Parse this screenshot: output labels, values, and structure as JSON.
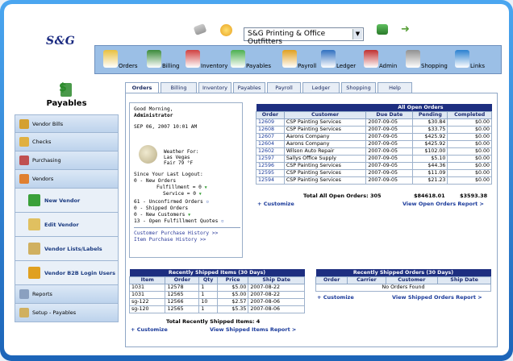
{
  "app": {
    "logo": "S&G",
    "module_title": "Payables",
    "company": "S&G Printing & Office Outfitters"
  },
  "nav": [
    {
      "label": "Orders",
      "icon": "orders-icon",
      "color": "#e8c040"
    },
    {
      "label": "Billing",
      "icon": "billing-icon",
      "color": "#3a8a3a"
    },
    {
      "label": "Inventory",
      "icon": "inventory-icon",
      "color": "#d04040"
    },
    {
      "label": "Payables",
      "icon": "payables-icon",
      "color": "#4caf50"
    },
    {
      "label": "Payroll",
      "icon": "payroll-icon",
      "color": "#e0a020"
    },
    {
      "label": "Ledger",
      "icon": "ledger-icon",
      "color": "#3070c0"
    },
    {
      "label": "Admin",
      "icon": "admin-icon",
      "color": "#c03030"
    },
    {
      "label": "Shopping",
      "icon": "shopping-icon",
      "color": "#909090"
    },
    {
      "label": "Links",
      "icon": "links-icon",
      "color": "#2a80d0"
    }
  ],
  "sidebar": {
    "items_top": [
      {
        "label": "Vendor Bills",
        "icon": "vendor-bills-icon",
        "color": "#d4a030"
      },
      {
        "label": "Checks",
        "icon": "checks-icon",
        "color": "#e0b040"
      },
      {
        "label": "Purchasing",
        "icon": "purchasing-icon",
        "color": "#c05050"
      },
      {
        "label": "Vendors",
        "icon": "vendors-icon",
        "color": "#e08030"
      }
    ],
    "sub_items": [
      {
        "label": "New Vendor",
        "icon": "plus-icon",
        "color": "#3aa03a"
      },
      {
        "label": "Edit Vendor",
        "icon": "edit-icon",
        "color": "#e0c060"
      },
      {
        "label": "Vendor Lists/Labels",
        "icon": "list-icon",
        "color": "#d0b060"
      },
      {
        "label": "Vendor B2B Login Users",
        "icon": "b2b-icon",
        "color": "#e0a020"
      }
    ],
    "items_bottom": [
      {
        "label": "Reports",
        "icon": "reports-icon",
        "color": "#8aa0c0"
      },
      {
        "label": "Setup - Payables",
        "icon": "setup-icon",
        "color": "#d0b060"
      }
    ]
  },
  "tabs": [
    "Orders",
    "Billing",
    "Inventory",
    "Payables",
    "Payroll",
    "Ledger",
    "Shopping",
    "Help"
  ],
  "greeting": {
    "hello": "Good Morning,",
    "user": "Administrator",
    "datetime": "SEP 06, 2007 10:01 AM",
    "weather_for": "Weather For:",
    "city": "Las Vegas",
    "forecast": "Fair 79 °F",
    "since": "Since Your Last Logout:",
    "new_orders": "0 - New Orders",
    "fulfillment": "Fulfillment = 0",
    "service": "Service = 0",
    "unconfirmed": "61 - Unconfirmed Orders",
    "shipped": "0 - Shipped Orders",
    "new_customers": "0 - New Customers",
    "open_quotes": "13 - Open Fulfillment Quotes",
    "link_customer": "Customer Purchase History >>",
    "link_item": "Item Purchase History >>"
  },
  "open_orders": {
    "caption": "All Open Orders",
    "headers": [
      "Order",
      "Customer",
      "Due Date",
      "Pending",
      "Completed"
    ],
    "rows": [
      [
        "12609",
        "CSP Painting Services",
        "2007-09-05",
        "$30.84",
        "$0.00"
      ],
      [
        "12608",
        "CSP Painting Services",
        "2007-09-05",
        "$33.75",
        "$0.00"
      ],
      [
        "12607",
        "Aarons Company",
        "2007-09-05",
        "$425.92",
        "$0.00"
      ],
      [
        "12604",
        "Aarons Company",
        "2007-09-05",
        "$425.92",
        "$0.00"
      ],
      [
        "12602",
        "Wilson Auto Repair",
        "2007-09-05",
        "$102.00",
        "$0.00"
      ],
      [
        "12597",
        "Sallys Office Supply",
        "2007-09-05",
        "$5.10",
        "$0.00"
      ],
      [
        "12596",
        "CSP Painting Services",
        "2007-09-05",
        "$44.36",
        "$0.00"
      ],
      [
        "12595",
        "CSP Painting Services",
        "2007-09-05",
        "$11.09",
        "$0.00"
      ],
      [
        "12594",
        "CSP Painting Services",
        "2007-09-05",
        "$21.23",
        "$0.00"
      ]
    ],
    "total_label": "Total All Open Orders: 305",
    "total_pending": "$84618.01",
    "total_completed": "$3593.38",
    "customize": "+ Customize",
    "report_link": "View Open Orders Report >"
  },
  "shipped_items": {
    "caption": "Recently Shipped Items (30 Days)",
    "headers": [
      "Item",
      "Order",
      "Qty",
      "Price",
      "Ship Date"
    ],
    "rows": [
      [
        "1031",
        "12578",
        "1",
        "$5.00",
        "2007-08-22"
      ],
      [
        "1031",
        "12565",
        "1",
        "$5.00",
        "2007-08-22"
      ],
      [
        "sg-122",
        "12566",
        "10",
        "$2.57",
        "2007-08-06"
      ],
      [
        "sg-120",
        "12565",
        "1",
        "$5.35",
        "2007-08-06"
      ]
    ],
    "total_label": "Total Recently Shipped Items: 4",
    "customize": "+ Customize",
    "report_link": "View Shipped Items Report >"
  },
  "shipped_orders": {
    "caption": "Recently Shipped Orders (30 Days)",
    "headers": [
      "Order",
      "Carrier",
      "Customer",
      "Ship Date"
    ],
    "empty": "No Orders Found",
    "customize": "+ Customize",
    "report_link": "View Shipped Orders Report >"
  }
}
